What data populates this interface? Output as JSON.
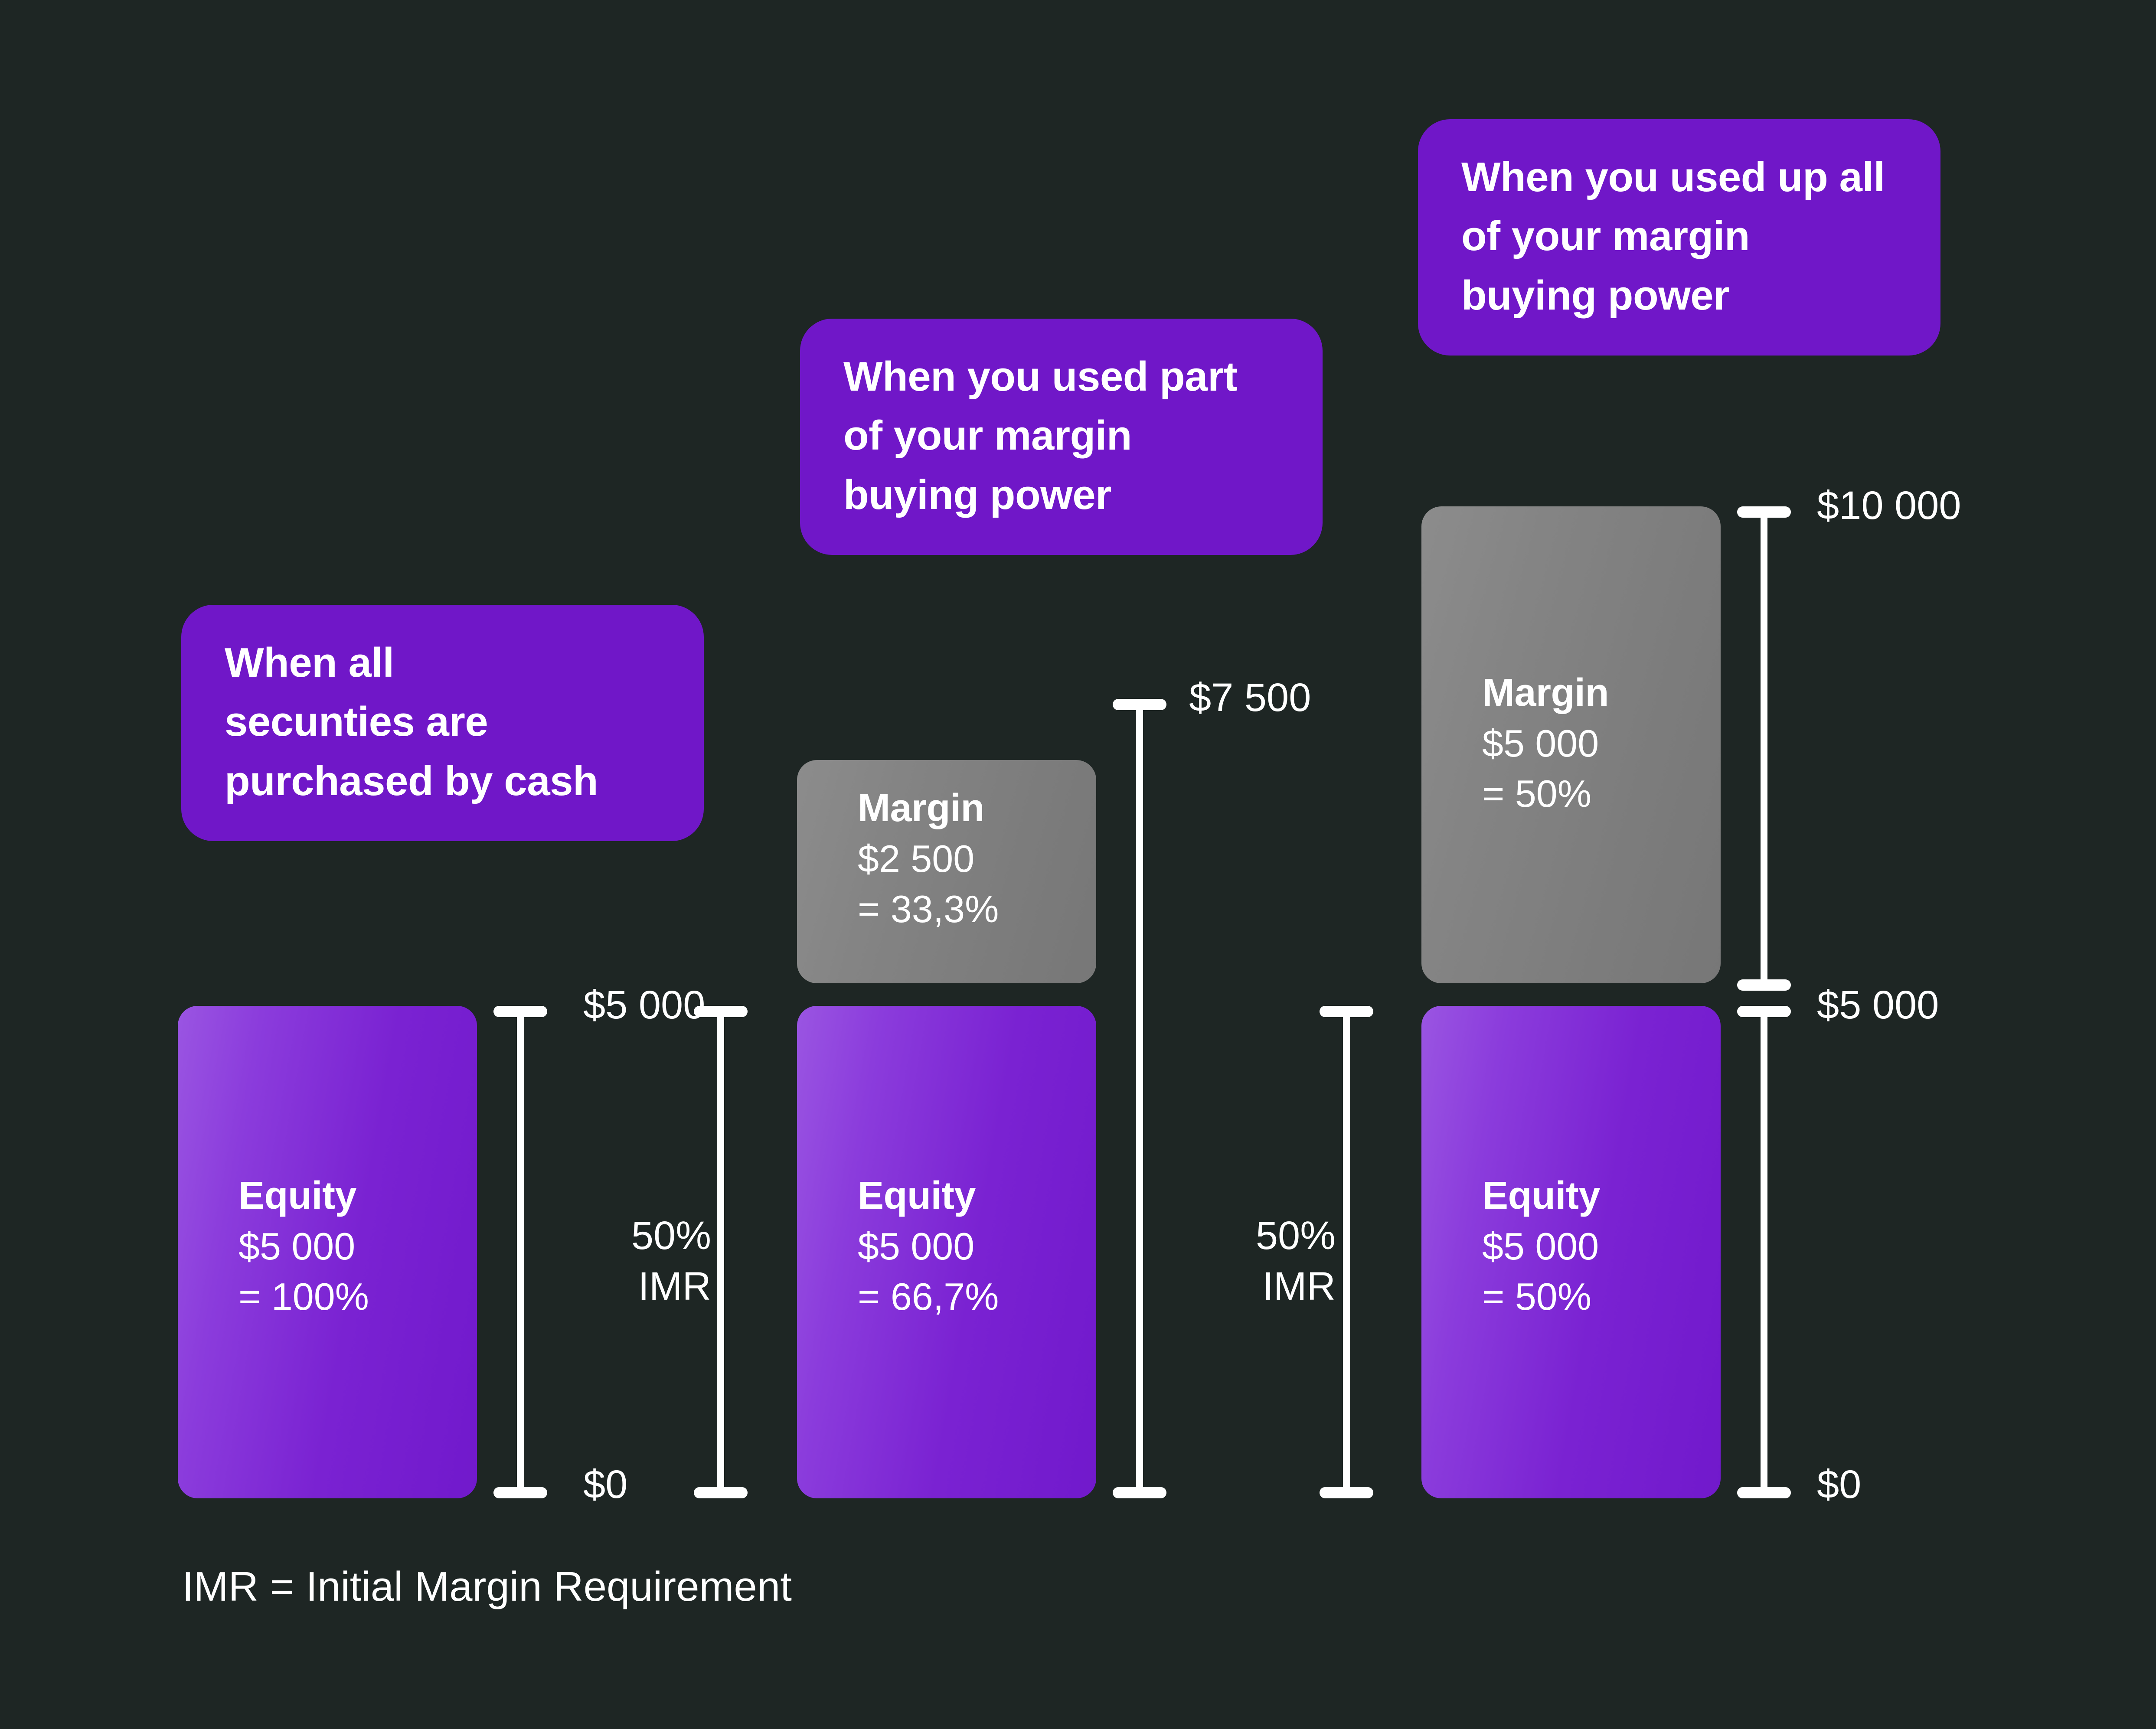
{
  "background_color": "#1E2624",
  "accent_purple": "#7017C8",
  "equity_color": "#8B3CDC",
  "margin_color": "#808080",
  "text_color": "#FFFFFF",
  "callouts": [
    {
      "id": "cash",
      "text": "When all\nsecunties are\npurchased by cash"
    },
    {
      "id": "part-margin",
      "text": "When you used part\nof your margin\nbuying power"
    },
    {
      "id": "all-margin",
      "text": "When you used up all\nof your margin\nbuying power"
    }
  ],
  "groups": [
    {
      "id": "group-cash",
      "equity": {
        "title": "Equity",
        "value": "$5 000",
        "percent": "= 100%"
      },
      "margin": null,
      "axis": {
        "top": "$5 000",
        "mid": null,
        "bottom": "$0"
      },
      "imr": null
    },
    {
      "id": "group-part-margin",
      "equity": {
        "title": "Equity",
        "value": "$5 000",
        "percent": "= 66,7%"
      },
      "margin": {
        "title": "Margin",
        "value": "$2 500",
        "percent": "= 33,3%"
      },
      "axis": {
        "top": "$7 500",
        "mid": null,
        "bottom": null
      },
      "imr": "50%\nIMR"
    },
    {
      "id": "group-all-margin",
      "equity": {
        "title": "Equity",
        "value": "$5 000",
        "percent": "= 50%"
      },
      "margin": {
        "title": "Margin",
        "value": "$5 000",
        "percent": "= 50%"
      },
      "axis": {
        "top": "$10 000",
        "mid": "$5 000",
        "bottom": "$0"
      },
      "imr": "50%\nIMR"
    }
  ],
  "imr_left_group2": "50%\nIMR",
  "footer": "IMR = Initial Margin Requirement",
  "chart_data": {
    "type": "bar",
    "title": "Margin account composition at different levels of margin use",
    "categories": [
      "When all secunties are purchased by cash",
      "When you used part of your margin buying power",
      "When you used up all of your margin buying power"
    ],
    "series": [
      {
        "name": "Equity",
        "values": [
          5000,
          5000,
          5000
        ],
        "percents": [
          "100%",
          "66,7%",
          "50%"
        ],
        "color": "#8B3CDC"
      },
      {
        "name": "Margin",
        "values": [
          0,
          2500,
          5000
        ],
        "percents": [
          "0%",
          "33,3%",
          "50%"
        ],
        "color": "#808080"
      }
    ],
    "totals": [
      5000,
      7500,
      10000
    ],
    "total_labels": [
      "$5 000",
      "$7 500",
      "$10 000"
    ],
    "axis_tick_labels": [
      "$0",
      "$5 000",
      "$7 500",
      "$10 000"
    ],
    "ylim": [
      0,
      10000
    ],
    "ylabel": "",
    "xlabel": "",
    "annotations": [
      "50% IMR",
      "50% IMR",
      "IMR = Initial Margin Requirement"
    ],
    "grid": false,
    "legend": "none",
    "stacked": true
  }
}
